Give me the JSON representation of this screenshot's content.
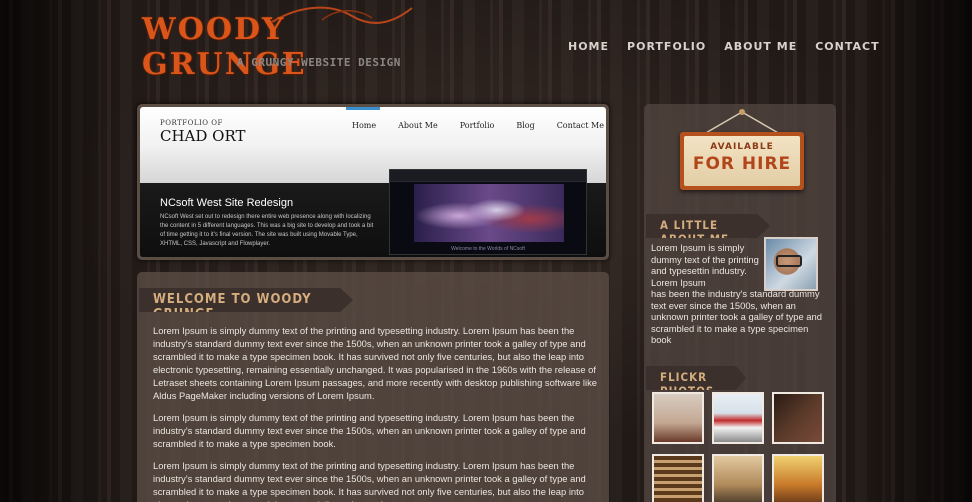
{
  "site": {
    "logo_title": "WOODY GRUNGE",
    "logo_subtitle": "A GRUNGY WEBSITE DESIGN"
  },
  "topnav": {
    "items": [
      {
        "label": "HOME"
      },
      {
        "label": "PORTFOLIO"
      },
      {
        "label": "ABOUT ME"
      },
      {
        "label": "CONTACT"
      }
    ]
  },
  "slider": {
    "kicker": "PORTFOLIO OF",
    "name": "CHAD ORT",
    "nav": [
      "Home",
      "About Me",
      "Portfolio",
      "Blog",
      "Contact Me"
    ],
    "project_title": "NCsoft West Site Redesign",
    "project_text": "NCsoft West set out to redesign there entire web presence along with localizing the content in 5 different languages. This was a big site to develop and took a bit of time getting it to it's final version. The site was built using Movable Type, XHTML, CSS, Javascript and Flowplayer.",
    "screenshot_caption": "Welcome to the Worlds of NCsoft"
  },
  "welcome": {
    "heading": "WELCOME TO WOODY GRUNGE",
    "paragraphs": [
      "Lorem Ipsum is simply dummy text of the printing and typesetting industry. Lorem Ipsum has been the industry's standard dummy text ever since the 1500s, when an unknown printer took a galley of type and scrambled it to make a type specimen book. It has survived not only five centuries, but also the leap into electronic typesetting, remaining essentially unchanged. It was popularised in the 1960s with the release of Letraset sheets containing Lorem Ipsum passages, and more recently with desktop publishing software like Aldus PageMaker including versions of Lorem Ipsum.",
      "Lorem Ipsum is simply dummy text of the printing and typesetting industry. Lorem Ipsum has been the industry's standard dummy text ever since the 1500s, when an unknown printer took a galley of type and scrambled it to make a type specimen book.",
      "Lorem Ipsum is simply dummy text of the printing and typesetting industry. Lorem Ipsum has been the industry's standard dummy text ever since the 1500s, when an unknown printer took a galley of type and scrambled it to make a type specimen book. It has survived not only five centuries, but also the leap into electronic typesetting, remaining essentially unchanged."
    ]
  },
  "sidebar": {
    "hire_line1": "AVAILABLE",
    "hire_line2": "FOR HIRE",
    "about_heading": "A LITTLE ABOUT ME",
    "about_text_narrow": "Lorem Ipsum is simply dummy text of the printing and typesettin industry. Lorem Ipsum",
    "about_text_wide": "has been the industry's standard dummy text ever since the 1500s, when an unknown printer took a galley of type and scrambled it to make a type specimen book",
    "flickr_heading": "FLICKR PHOTOS"
  },
  "colors": {
    "accent_orange": "#d9551a",
    "heading_gold": "#d5ad7e",
    "nav_text": "#d8d2cc"
  }
}
